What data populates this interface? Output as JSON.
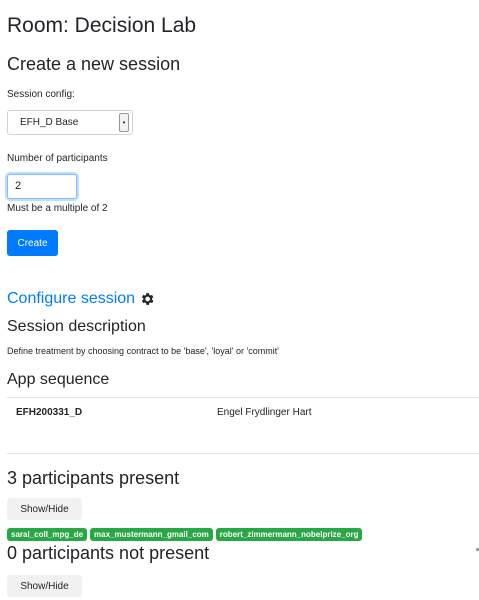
{
  "page": {
    "title": "Room: Decision Lab"
  },
  "create_session": {
    "heading": "Create a new session",
    "config_label": "Session config:",
    "config_value": "EFH_D Base",
    "participants_label": "Number of participants",
    "participants_value": "2",
    "participants_help": "Must be a multiple of 2",
    "create_button": "Create"
  },
  "configure": {
    "link_label": "Configure session",
    "icon": "gear-icon",
    "description_heading": "Session description",
    "description_text": "Define treatment by choosing contract to be 'base', 'loyal' or 'commit'",
    "app_sequence_heading": "App sequence",
    "apps": [
      {
        "name": "EFH200331_D",
        "display_name": "Engel Frydlinger Hart"
      }
    ]
  },
  "present": {
    "heading": "3 participants present",
    "toggle_label": "Show/Hide",
    "participants": [
      "saral_coll_mpg_de",
      "max_mustermann_gmail_com",
      "robert_zimmermann_nobelprize_org"
    ]
  },
  "not_present": {
    "heading": "0 participants not present",
    "toggle_label": "Show/Hide"
  },
  "colors": {
    "primary": "#007bff",
    "success": "#28a745",
    "text": "#212529"
  }
}
